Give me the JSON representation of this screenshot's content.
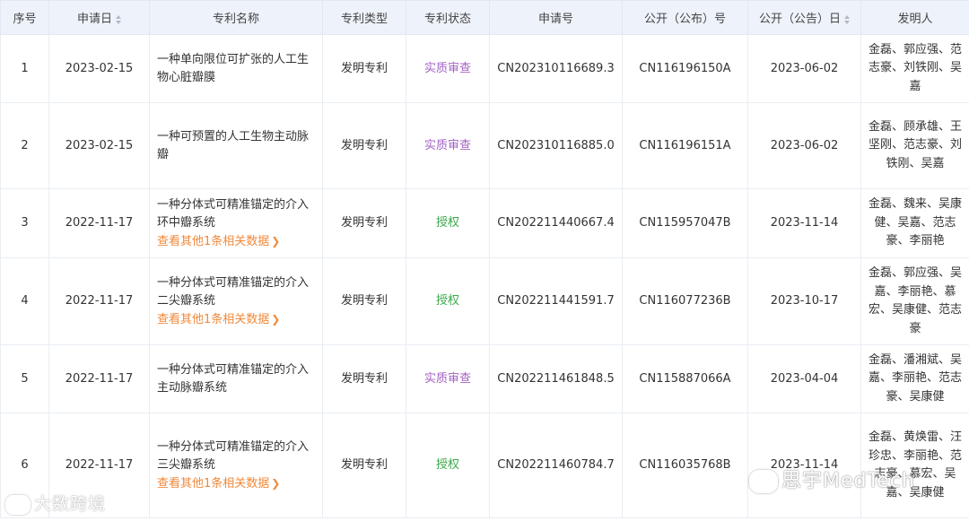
{
  "headers": [
    "序号",
    "申请日",
    "专利名称",
    "专利类型",
    "专利状态",
    "申请号",
    "公开（公布）号",
    "公开（公告）日",
    "发明人"
  ],
  "rows": [
    {
      "no": "1",
      "date": "2023-02-15",
      "name": "一种单向限位可扩张的人工生物心脏瓣膜",
      "more": "",
      "type": "发明专利",
      "status": "实质审查",
      "app_no": "CN202310116689.3",
      "pub_no": "CN116196150A",
      "pub_date": "2023-06-02",
      "inventors": "金磊、郭应强、范志豪、刘铁刚、吴嘉"
    },
    {
      "no": "2",
      "date": "2023-02-15",
      "name": "一种可预置的人工生物主动脉瓣",
      "more": "",
      "type": "发明专利",
      "status": "实质审查",
      "app_no": "CN202310116885.0",
      "pub_no": "CN116196151A",
      "pub_date": "2023-06-02",
      "inventors": "金磊、顾承雄、王坚刚、范志豪、刘铁刚、吴嘉"
    },
    {
      "no": "3",
      "date": "2022-11-17",
      "name": "一种分体式可精准锚定的介入环中瓣系统",
      "more": "查看其他1条相关数据",
      "type": "发明专利",
      "status": "授权",
      "app_no": "CN202211440667.4",
      "pub_no": "CN115957047B",
      "pub_date": "2023-11-14",
      "inventors": "金磊、魏来、吴康健、吴嘉、范志豪、李丽艳"
    },
    {
      "no": "4",
      "date": "2022-11-17",
      "name": "一种分体式可精准锚定的介入二尖瓣系统",
      "more": "查看其他1条相关数据",
      "type": "发明专利",
      "status": "授权",
      "app_no": "CN202211441591.7",
      "pub_no": "CN116077236B",
      "pub_date": "2023-10-17",
      "inventors": "金磊、郭应强、吴嘉、李丽艳、慕宏、吴康健、范志豪"
    },
    {
      "no": "5",
      "date": "2022-11-17",
      "name": "一种分体式可精准锚定的介入主动脉瓣系统",
      "more": "",
      "type": "发明专利",
      "status": "实质审查",
      "app_no": "CN202211461848.5",
      "pub_no": "CN115887066A",
      "pub_date": "2023-04-04",
      "inventors": "金磊、潘湘斌、吴嘉、李丽艳、范志豪、吴康健"
    },
    {
      "no": "6",
      "date": "2022-11-17",
      "name": "一种分体式可精准锚定的介入三尖瓣系统",
      "more": "查看其他1条相关数据",
      "type": "发明专利",
      "status": "授权",
      "app_no": "CN202211460784.7",
      "pub_no": "CN116035768B",
      "pub_date": "2023-11-14",
      "inventors": "金磊、黄焕雷、汪珍忠、李丽艳、范志豪、慕宏、吴嘉、吴康健"
    }
  ],
  "status_colors": {
    "实质审查": "#a463c5",
    "授权": "#39a94a"
  },
  "watermarks": {
    "left": "大数跨境",
    "right": "思宇MedTech"
  }
}
